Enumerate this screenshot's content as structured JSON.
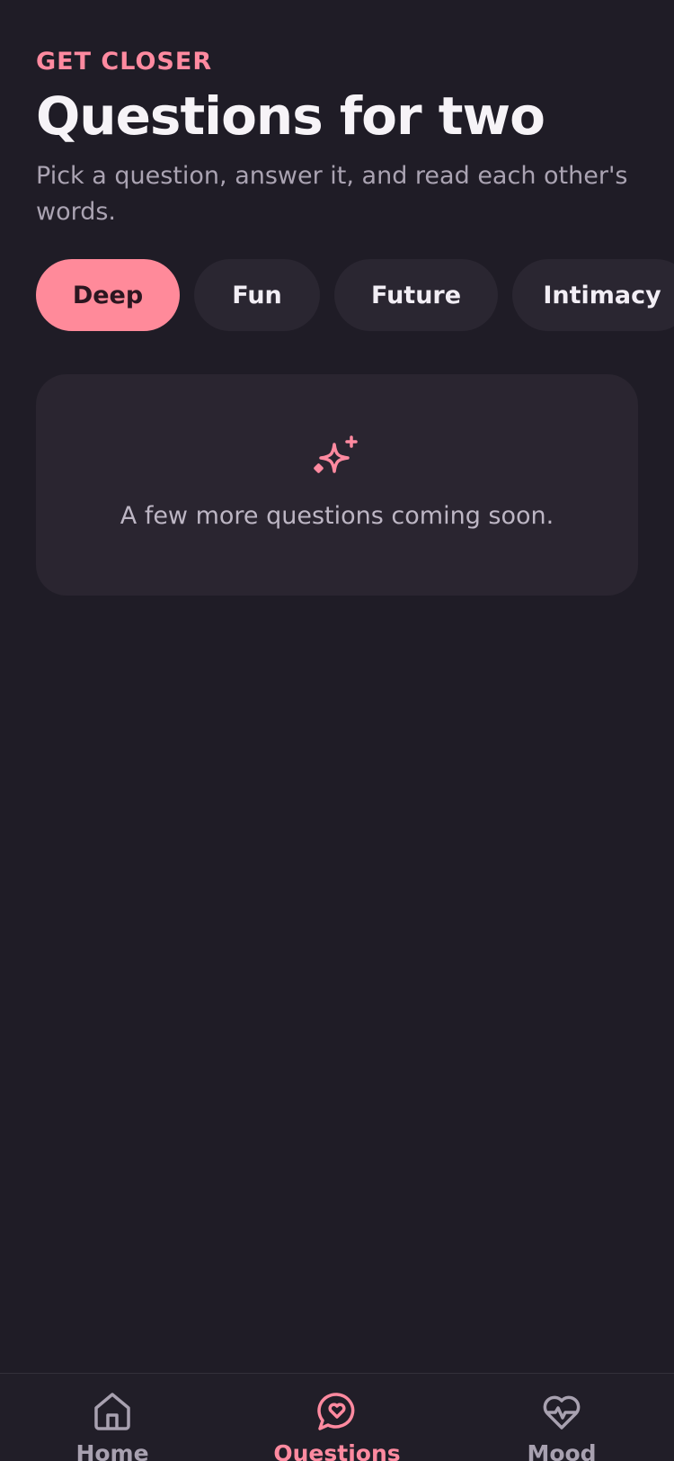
{
  "header": {
    "eyebrow": "GET CLOSER",
    "title": "Questions for two",
    "subtitle": "Pick a question, answer it, and read each other's words."
  },
  "categories": {
    "selected": "Deep",
    "items": [
      {
        "label": "Deep"
      },
      {
        "label": "Fun"
      },
      {
        "label": "Future"
      },
      {
        "label": "Intimacy"
      }
    ]
  },
  "empty_state": {
    "icon": "sparkle-icon",
    "message": "A few more questions coming soon."
  },
  "bottom_nav": {
    "items": [
      {
        "label": "Home",
        "icon": "home-icon"
      },
      {
        "label": "Questions",
        "icon": "heart-chat-icon"
      },
      {
        "label": "Mood",
        "icon": "heart-pulse-icon"
      }
    ],
    "active": "Questions"
  },
  "colors": {
    "background": "#1f1c26",
    "accent": "#ff8a9a",
    "surface": "#2a2530"
  }
}
